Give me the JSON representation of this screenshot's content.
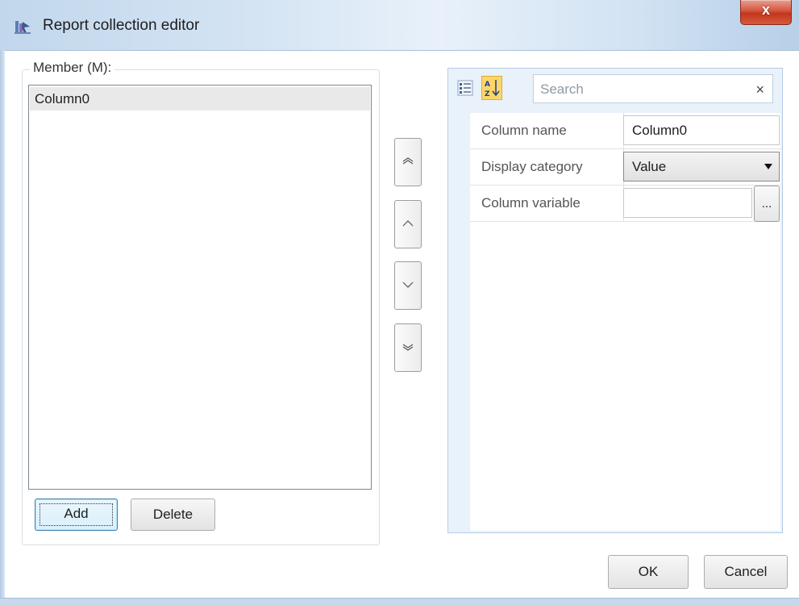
{
  "window": {
    "title": "Report collection editor",
    "close_glyph": "x",
    "app_icon": "report-editor-icon"
  },
  "members": {
    "label": "Member (M):",
    "items": [
      "Column0"
    ],
    "selected_index": 0
  },
  "member_buttons": {
    "add": "Add",
    "delete": "Delete"
  },
  "move_buttons": [
    "move-to-top",
    "move-up",
    "move-down",
    "move-to-bottom"
  ],
  "property_grid": {
    "search_placeholder": "Search",
    "search_clear": "×",
    "toolbar_icons": [
      "categorized-icon",
      "alphabetical-sort-icon"
    ],
    "rows": [
      {
        "name": "Column name",
        "value": "Column0",
        "kind": "text"
      },
      {
        "name": "Display category",
        "value": "Value",
        "kind": "dropdown"
      },
      {
        "name": "Column variable",
        "value": "",
        "kind": "ellipsis"
      }
    ],
    "ellipsis": "..."
  },
  "dialog_buttons": {
    "ok": "OK",
    "cancel": "Cancel"
  },
  "colors": {
    "titlebar": "#d3e3f3",
    "close_button": "#c2361c",
    "selection": "#e9e9e9",
    "property_grid_border": "#b6cde6",
    "sort_active": "#fcd66a"
  }
}
